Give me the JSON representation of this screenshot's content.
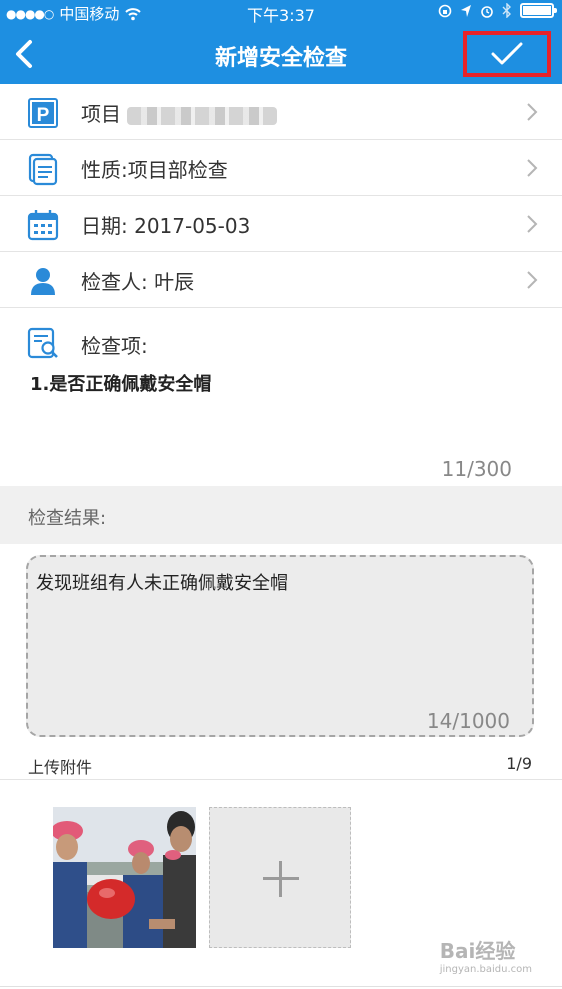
{
  "status_bar": {
    "signal_dots": "●●●●○",
    "carrier": "中国移动",
    "time": "下午3:37"
  },
  "nav": {
    "title": "新增安全检查"
  },
  "rows": {
    "project_label": "项目",
    "nature_label": "性质:项目部检查",
    "date_label": "日期: 2017-05-03",
    "inspector_label": "检查人: 叶辰"
  },
  "inspect": {
    "label": "检查项:",
    "content": "1.是否正确佩戴安全帽",
    "counter": "11/300"
  },
  "result": {
    "heading": "检查结果:",
    "text": "发现班组有人未正确佩戴安全帽",
    "counter": "14/1000"
  },
  "upload": {
    "label": "上传附件",
    "count": "1/9"
  },
  "watermark": {
    "brand": "Bai经验",
    "url": "jingyan.baidu.com"
  },
  "colors": {
    "header_bg": "#1e8fe1",
    "icon_blue": "#2a8ad8",
    "highlight_red": "#e8222a"
  }
}
